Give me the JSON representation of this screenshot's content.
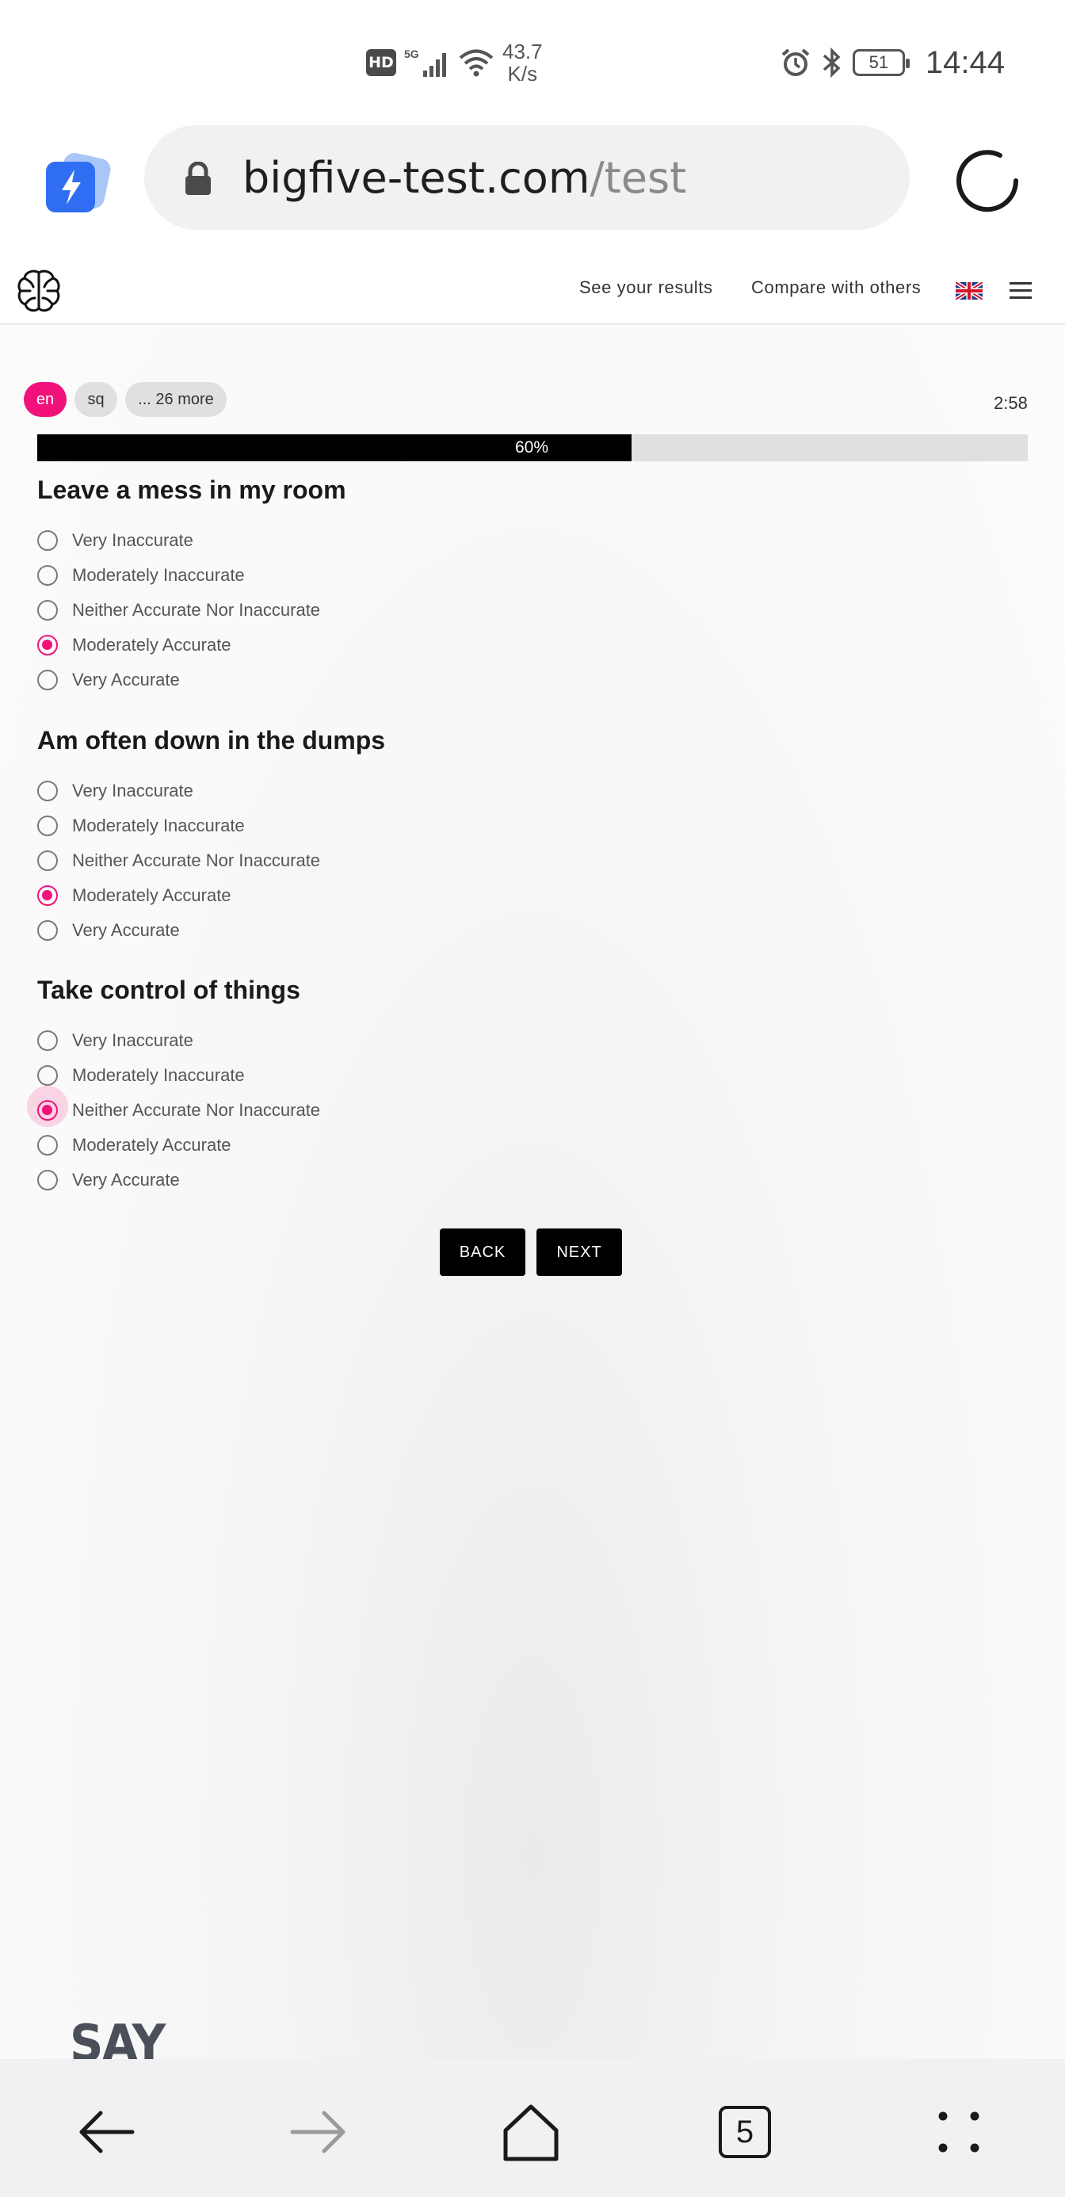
{
  "status_bar": {
    "hd_badge": "HD",
    "network": "5G",
    "speed_value": "43.7",
    "speed_unit": "K/s",
    "battery": "51",
    "time": "14:44"
  },
  "browser": {
    "url_domain": "bigfive-test.com",
    "url_path": "/test",
    "tab_count": "5"
  },
  "site_nav": {
    "results_link": "See your results",
    "compare_link": "Compare with others"
  },
  "languages": {
    "items": [
      "en",
      "sq",
      "... 26 more"
    ],
    "active": "en"
  },
  "timer": "2:58",
  "progress": {
    "percent": 60,
    "label": "60%"
  },
  "questions": [
    {
      "title": "Leave a mess in my room",
      "options": [
        "Very Inaccurate",
        "Moderately Inaccurate",
        "Neither Accurate Nor Inaccurate",
        "Moderately Accurate",
        "Very Accurate"
      ],
      "selected": 3
    },
    {
      "title": "Am often down in the dumps",
      "options": [
        "Very Inaccurate",
        "Moderately Inaccurate",
        "Neither Accurate Nor Inaccurate",
        "Moderately Accurate",
        "Very Accurate"
      ],
      "selected": 3
    },
    {
      "title": "Take control of things",
      "options": [
        "Very Inaccurate",
        "Moderately Inaccurate",
        "Neither Accurate Nor Inaccurate",
        "Moderately Accurate",
        "Very Accurate"
      ],
      "selected": 2
    }
  ],
  "buttons": {
    "back": "BACK",
    "next": "NEXT"
  },
  "footer_text": "SAY",
  "colors": {
    "accent": "#f2117a",
    "button_bg": "#000000",
    "progress_track": "#e0e0e0"
  }
}
